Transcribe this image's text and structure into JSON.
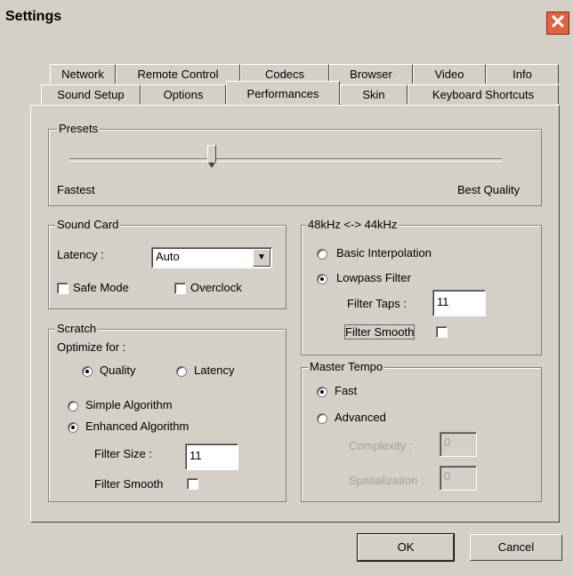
{
  "window": {
    "title": "Settings",
    "close_glyph": "✕"
  },
  "tabs_row1": [
    "Network",
    "Remote Control",
    "Codecs",
    "Browser",
    "Video",
    "Info"
  ],
  "tabs_row2": [
    "Sound Setup",
    "Options",
    "Performances",
    "Skin",
    "Keyboard Shortcuts"
  ],
  "active_tab": "Performances",
  "presets": {
    "legend": "Presets",
    "left_label": "Fastest",
    "right_label": "Best Quality",
    "slider_value": 0.33
  },
  "sound_card": {
    "legend": "Sound Card",
    "latency_label": "Latency :",
    "latency_value": "Auto",
    "safe_mode_label": "Safe Mode",
    "safe_mode_checked": false,
    "overclock_label": "Overclock",
    "overclock_checked": false
  },
  "scratch": {
    "legend": "Scratch",
    "optimize_label": "Optimize for :",
    "quality_label": "Quality",
    "latency_label": "Latency",
    "simple_label": "Simple Algorithm",
    "enhanced_label": "Enhanced Algorithm",
    "filter_size_label": "Filter Size :",
    "filter_size_value": "11",
    "filter_smooth_label": "Filter Smooth"
  },
  "resample": {
    "legend": "48kHz <-> 44kHz",
    "basic_label": "Basic Interpolation",
    "lowpass_label": "Lowpass Filter",
    "filter_taps_label": "Filter Taps :",
    "filter_taps_value": "11",
    "filter_smooth_label": "Filter Smooth"
  },
  "master_tempo": {
    "legend": "Master Tempo",
    "fast_label": "Fast",
    "advanced_label": "Advanced",
    "complexity_label": "Complexity :",
    "complexity_value": "0",
    "spatialization_label": "Spatialization :",
    "spatialization_value": "0"
  },
  "buttons": {
    "ok": "OK",
    "cancel": "Cancel"
  }
}
